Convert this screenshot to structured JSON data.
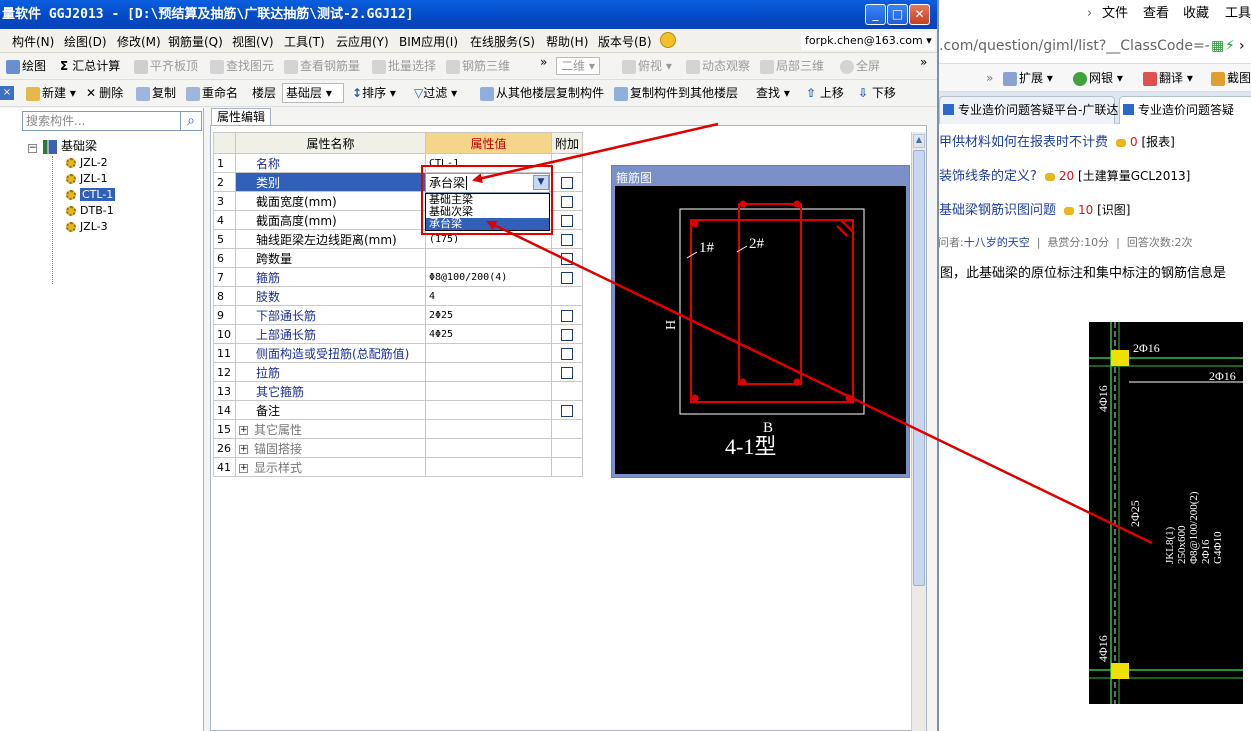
{
  "window": {
    "title": "量软件 GGJ2013 - [D:\\预结算及抽筋\\广联达抽筋\\测试-2.GGJ12]"
  },
  "menubar": {
    "items": [
      "构件(N)",
      "绘图(D)",
      "修改(M)",
      "钢筋量(Q)",
      "视图(V)",
      "工具(T)",
      "云应用(Y)",
      "BIM应用(I)",
      "在线服务(S)",
      "帮助(H)",
      "版本号(B)"
    ],
    "user": "forpk.chen@163.com"
  },
  "toolbar1": {
    "draw": "绘图",
    "sum": "汇总计算",
    "flat": "平齐板顶",
    "find_elem": "查找图元",
    "view_rebar": "查看钢筋量",
    "batch": "批量选择",
    "rebar3d": "钢筋三维",
    "twod": "二维",
    "top_view": "俯视",
    "dyn_view": "动态观察",
    "local3d": "局部三维",
    "fullscreen": "全屏"
  },
  "toolbar2": {
    "new": "新建",
    "delete": "删除",
    "copy": "复制",
    "rename": "重命名",
    "floor_label": "楼层",
    "floor_value": "基础层",
    "sort": "排序",
    "filter": "过滤",
    "copy_from": "从其他楼层复制构件",
    "copy_to": "复制构件到其他楼层",
    "find": "查找",
    "up": "上移",
    "down": "下移"
  },
  "left_panel": {
    "search_placeholder": "搜索构件...",
    "root": "基础梁",
    "items": [
      "JZL-2",
      "JZL-1",
      "CTL-1",
      "DTB-1",
      "JZL-3"
    ],
    "selected": "CTL-1"
  },
  "tab": {
    "label": "属性编辑"
  },
  "grid": {
    "headers": {
      "name": "属性名称",
      "value": "属性值",
      "extra": "附加"
    },
    "rows": [
      {
        "no": "1",
        "name": "名称",
        "value": "CTL-1",
        "blue": true,
        "chk": false
      },
      {
        "no": "2",
        "name": "类别",
        "value": "",
        "blue": true,
        "chk": true,
        "sel": true
      },
      {
        "no": "3",
        "name": "截面宽度(mm)",
        "value": "",
        "blue": false,
        "chk": true
      },
      {
        "no": "4",
        "name": "截面高度(mm)",
        "value": "",
        "blue": false,
        "chk": true
      },
      {
        "no": "5",
        "name": "轴线距梁左边线距离(mm)",
        "value": "(175)",
        "blue": false,
        "chk": true
      },
      {
        "no": "6",
        "name": "跨数量",
        "value": "",
        "blue": false,
        "chk": true
      },
      {
        "no": "7",
        "name": "箍筋",
        "value": "Φ8@100/200(4)",
        "blue": true,
        "chk": true
      },
      {
        "no": "8",
        "name": "肢数",
        "value": "4",
        "blue": true,
        "chk": false
      },
      {
        "no": "9",
        "name": "下部通长筋",
        "value": "2Φ25",
        "blue": true,
        "chk": true
      },
      {
        "no": "10",
        "name": "上部通长筋",
        "value": "4Φ25",
        "blue": true,
        "chk": true
      },
      {
        "no": "11",
        "name": "侧面构造或受扭筋(总配筋值)",
        "value": "",
        "blue": true,
        "chk": true
      },
      {
        "no": "12",
        "name": "拉筋",
        "value": "",
        "blue": true,
        "chk": true
      },
      {
        "no": "13",
        "name": "其它箍筋",
        "value": "",
        "blue": true,
        "chk": false
      },
      {
        "no": "14",
        "name": "备注",
        "value": "",
        "blue": false,
        "chk": true
      },
      {
        "no": "15",
        "name": "其它属性",
        "value": "",
        "gray": true,
        "plus": true
      },
      {
        "no": "26",
        "name": "锚固搭接",
        "value": "",
        "gray": true,
        "plus": true
      },
      {
        "no": "41",
        "name": "显示样式",
        "value": "",
        "gray": true,
        "plus": true
      }
    ]
  },
  "combo": {
    "value": "承台梁",
    "options": [
      "基础主梁",
      "基础次梁",
      "承台梁"
    ],
    "selected_index": 2
  },
  "stirrup": {
    "title": "箍筋图",
    "label1": "1#",
    "label2": "2#",
    "h": "H",
    "b": "B",
    "type": "4-1型"
  },
  "right": {
    "menu": [
      "文件",
      "查看",
      "收藏",
      "工具"
    ],
    "address": ".com/question/giml/list?__ClassCode=-",
    "tools": [
      "扩展",
      "网银",
      "翻译",
      "截图"
    ],
    "tabs": [
      "专业造价问题答疑平台-广联达",
      "专业造价问题答疑"
    ],
    "questions": [
      {
        "title": "甲供材料如何在报表时不计费",
        "score": "0",
        "tag": "[报表]"
      },
      {
        "title": "装饰线条的定义?",
        "score": "20",
        "tag": "[土建算量GCL2013]"
      },
      {
        "title": "基础梁钢筋识图问题",
        "score": "10",
        "tag": "[识图]"
      }
    ],
    "meta": {
      "asker_label": "提问者:",
      "asker": "十八岁的天空",
      "reward": "悬赏分:10分",
      "answers": "回答次数:2次"
    },
    "question_text": "如图，此基础梁的原位标注和集中标注的钢筋信息是",
    "cad_labels": {
      "top1": "2Φ16",
      "top2": "2Φ16",
      "left1": "4Φ16",
      "mid": "2Φ25",
      "left2": "4Φ16",
      "beam": [
        "JKL8(1)",
        "250x600",
        "Φ8@100/200(2)",
        "2Φ16",
        "G4Φ10"
      ]
    }
  },
  "colors": {
    "accent_red": "#e00000",
    "title_blue": "#0349c4",
    "select_blue": "#3060b8"
  }
}
